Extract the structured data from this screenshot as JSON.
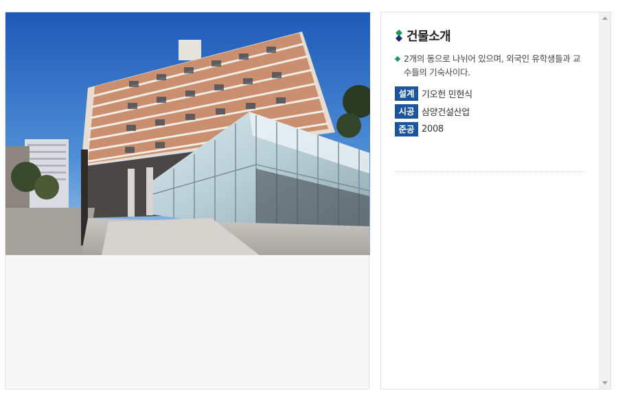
{
  "info": {
    "title": "건물소개",
    "description": "2개의 동으로 나뉘어 있으며, 외국인 유학생들과 교수들의 기숙사이다.",
    "specs": [
      {
        "label": "설계",
        "value": "기오헌 민현식"
      },
      {
        "label": "시공",
        "value": "삼양건설산업"
      },
      {
        "label": "준공",
        "value": "2008"
      }
    ]
  },
  "colors": {
    "label_bg": "#1a56a0",
    "bullet": "#1a9a5a",
    "icon_green": "#1a9a5a",
    "icon_navy": "#1b2f6b"
  },
  "icons": {
    "title_icon": "diamond-icon",
    "bullet_icon": "diamond-bullet-icon"
  }
}
